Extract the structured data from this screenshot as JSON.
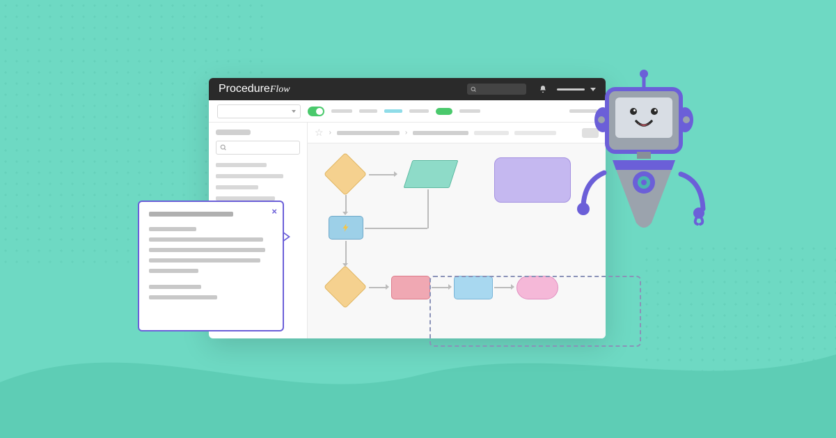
{
  "brand": {
    "prefix": "Procedure",
    "suffix": "Flow"
  },
  "titlebar": {
    "search_icon": "search",
    "bell_icon": "notifications",
    "menu_icon": "menu"
  },
  "toolbar": {
    "dropdown": "",
    "toggle": "on"
  },
  "popup": {
    "close_label": "×"
  },
  "flowchart": {
    "nodes": [
      {
        "id": "d1",
        "type": "decision",
        "color": "yellow"
      },
      {
        "id": "p1",
        "type": "data",
        "color": "teal"
      },
      {
        "id": "r1",
        "type": "process",
        "color": "purple"
      },
      {
        "id": "b1",
        "type": "action",
        "color": "blue",
        "icon": "lightning"
      },
      {
        "id": "d2",
        "type": "decision",
        "color": "yellow"
      },
      {
        "id": "r2",
        "type": "process",
        "color": "red"
      },
      {
        "id": "r3",
        "type": "process",
        "color": "blue"
      },
      {
        "id": "s1",
        "type": "terminator",
        "color": "pink"
      }
    ]
  },
  "robot": {
    "accent": "#6b5fd8",
    "body": "#9ba3ad"
  }
}
